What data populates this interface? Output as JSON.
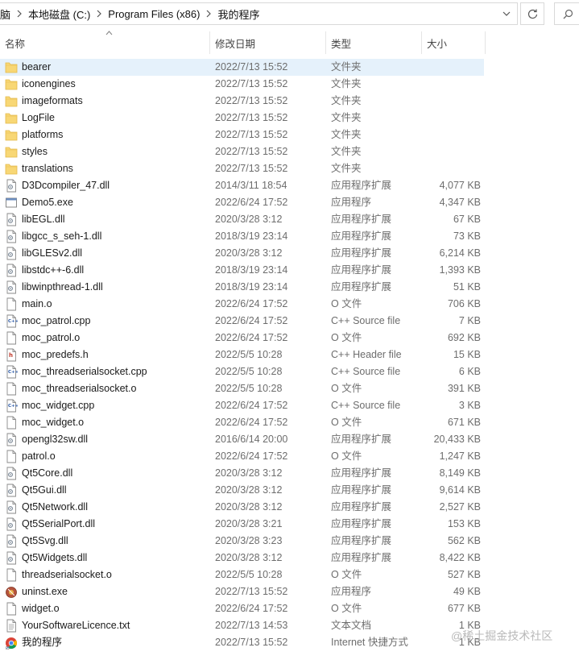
{
  "addressbar": {
    "crumbs": [
      "脑",
      "本地磁盘 (C:)",
      "Program Files (x86)",
      "我的程序"
    ]
  },
  "columns": {
    "name": "名称",
    "date": "修改日期",
    "type": "类型",
    "size": "大小"
  },
  "files": [
    {
      "name": "bearer",
      "date": "2022/7/13 15:52",
      "type": "文件夹",
      "size": "",
      "icon": "folder-icon",
      "selected": true
    },
    {
      "name": "iconengines",
      "date": "2022/7/13 15:52",
      "type": "文件夹",
      "size": "",
      "icon": "folder-icon"
    },
    {
      "name": "imageformats",
      "date": "2022/7/13 15:52",
      "type": "文件夹",
      "size": "",
      "icon": "folder-icon"
    },
    {
      "name": "LogFile",
      "date": "2022/7/13 15:52",
      "type": "文件夹",
      "size": "",
      "icon": "folder-icon"
    },
    {
      "name": "platforms",
      "date": "2022/7/13 15:52",
      "type": "文件夹",
      "size": "",
      "icon": "folder-icon"
    },
    {
      "name": "styles",
      "date": "2022/7/13 15:52",
      "type": "文件夹",
      "size": "",
      "icon": "folder-icon"
    },
    {
      "name": "translations",
      "date": "2022/7/13 15:52",
      "type": "文件夹",
      "size": "",
      "icon": "folder-icon"
    },
    {
      "name": "D3Dcompiler_47.dll",
      "date": "2014/3/11 18:54",
      "type": "应用程序扩展",
      "size": "4,077 KB",
      "icon": "dll-file-icon"
    },
    {
      "name": "Demo5.exe",
      "date": "2022/6/24 17:52",
      "type": "应用程序",
      "size": "4,347 KB",
      "icon": "exe-icon"
    },
    {
      "name": "libEGL.dll",
      "date": "2020/3/28 3:12",
      "type": "应用程序扩展",
      "size": "67 KB",
      "icon": "dll-file-icon"
    },
    {
      "name": "libgcc_s_seh-1.dll",
      "date": "2018/3/19 23:14",
      "type": "应用程序扩展",
      "size": "73 KB",
      "icon": "dll-file-icon"
    },
    {
      "name": "libGLESv2.dll",
      "date": "2020/3/28 3:12",
      "type": "应用程序扩展",
      "size": "6,214 KB",
      "icon": "dll-file-icon"
    },
    {
      "name": "libstdc++-6.dll",
      "date": "2018/3/19 23:14",
      "type": "应用程序扩展",
      "size": "1,393 KB",
      "icon": "dll-file-icon"
    },
    {
      "name": "libwinpthread-1.dll",
      "date": "2018/3/19 23:14",
      "type": "应用程序扩展",
      "size": "51 KB",
      "icon": "dll-file-icon"
    },
    {
      "name": "main.o",
      "date": "2022/6/24 17:52",
      "type": "O 文件",
      "size": "706 KB",
      "icon": "blank-file-icon"
    },
    {
      "name": "moc_patrol.cpp",
      "date": "2022/6/24 17:52",
      "type": "C++ Source file",
      "size": "7 KB",
      "icon": "cpp-file-icon"
    },
    {
      "name": "moc_patrol.o",
      "date": "2022/6/24 17:52",
      "type": "O 文件",
      "size": "692 KB",
      "icon": "blank-file-icon"
    },
    {
      "name": "moc_predefs.h",
      "date": "2022/5/5 10:28",
      "type": "C++ Header file",
      "size": "15 KB",
      "icon": "header-file-icon"
    },
    {
      "name": "moc_threadserialsocket.cpp",
      "date": "2022/5/5 10:28",
      "type": "C++ Source file",
      "size": "6 KB",
      "icon": "cpp-file-icon"
    },
    {
      "name": "moc_threadserialsocket.o",
      "date": "2022/5/5 10:28",
      "type": "O 文件",
      "size": "391 KB",
      "icon": "blank-file-icon"
    },
    {
      "name": "moc_widget.cpp",
      "date": "2022/6/24 17:52",
      "type": "C++ Source file",
      "size": "3 KB",
      "icon": "cpp-file-icon"
    },
    {
      "name": "moc_widget.o",
      "date": "2022/6/24 17:52",
      "type": "O 文件",
      "size": "671 KB",
      "icon": "blank-file-icon"
    },
    {
      "name": "opengl32sw.dll",
      "date": "2016/6/14 20:00",
      "type": "应用程序扩展",
      "size": "20,433 KB",
      "icon": "dll-file-icon"
    },
    {
      "name": "patrol.o",
      "date": "2022/6/24 17:52",
      "type": "O 文件",
      "size": "1,247 KB",
      "icon": "blank-file-icon"
    },
    {
      "name": "Qt5Core.dll",
      "date": "2020/3/28 3:12",
      "type": "应用程序扩展",
      "size": "8,149 KB",
      "icon": "dll-file-icon"
    },
    {
      "name": "Qt5Gui.dll",
      "date": "2020/3/28 3:12",
      "type": "应用程序扩展",
      "size": "9,614 KB",
      "icon": "dll-file-icon"
    },
    {
      "name": "Qt5Network.dll",
      "date": "2020/3/28 3:12",
      "type": "应用程序扩展",
      "size": "2,527 KB",
      "icon": "dll-file-icon"
    },
    {
      "name": "Qt5SerialPort.dll",
      "date": "2020/3/28 3:21",
      "type": "应用程序扩展",
      "size": "153 KB",
      "icon": "dll-file-icon"
    },
    {
      "name": "Qt5Svg.dll",
      "date": "2020/3/28 3:23",
      "type": "应用程序扩展",
      "size": "562 KB",
      "icon": "dll-file-icon"
    },
    {
      "name": "Qt5Widgets.dll",
      "date": "2020/3/28 3:12",
      "type": "应用程序扩展",
      "size": "8,422 KB",
      "icon": "dll-file-icon"
    },
    {
      "name": "threadserialsocket.o",
      "date": "2022/5/5 10:28",
      "type": "O 文件",
      "size": "527 KB",
      "icon": "blank-file-icon"
    },
    {
      "name": "uninst.exe",
      "date": "2022/7/13 15:52",
      "type": "应用程序",
      "size": "49 KB",
      "icon": "installer-icon"
    },
    {
      "name": "widget.o",
      "date": "2022/6/24 17:52",
      "type": "O 文件",
      "size": "677 KB",
      "icon": "blank-file-icon"
    },
    {
      "name": "YourSoftwareLicence.txt",
      "date": "2022/7/13 14:53",
      "type": "文本文档",
      "size": "1 KB",
      "icon": "text-file-icon"
    },
    {
      "name": "我的程序",
      "date": "2022/7/13 15:52",
      "type": "Internet 快捷方式",
      "size": "1 KB",
      "icon": "chrome-shortcut-icon"
    }
  ],
  "watermark": "@稀土掘金技术社区",
  "colors": {
    "selection": "#e5f1fb",
    "folder": "#f8d775",
    "border": "#d9d9d9"
  }
}
